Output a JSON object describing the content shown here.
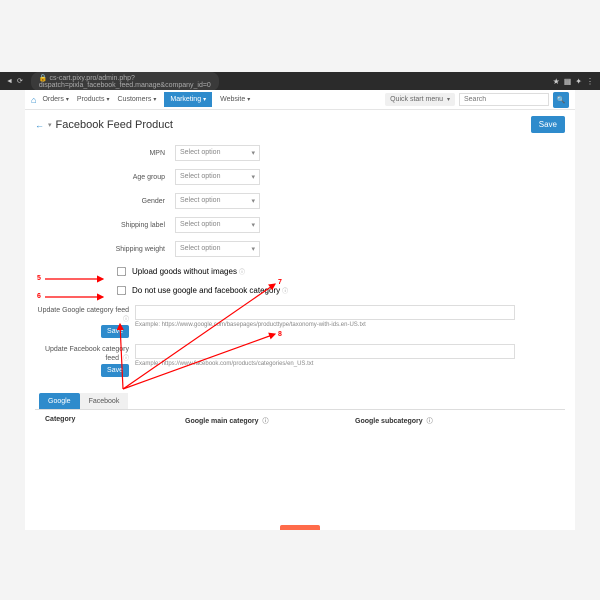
{
  "browser": {
    "url": "cs-cart.pixy.pro/admin.php?dispatch=pixla_facebook_feed.manage&company_id=0"
  },
  "nav": {
    "items": [
      "Orders",
      "Products",
      "Customers",
      "Marketing",
      "Website"
    ],
    "active": "Marketing",
    "quick": "Quick start menu",
    "search_placeholder": "Search"
  },
  "page": {
    "title": "Facebook Feed Product",
    "save": "Save"
  },
  "fields": {
    "mpn": {
      "label": "MPN",
      "value": "Select option"
    },
    "age_group": {
      "label": "Age group",
      "value": "Select option"
    },
    "gender": {
      "label": "Gender",
      "value": "Select option"
    },
    "shipping_label": {
      "label": "Shipping label",
      "value": "Select option"
    },
    "shipping_weight": {
      "label": "Shipping weight",
      "value": "Select option"
    }
  },
  "checkboxes": {
    "upload_no_images": "Upload goods without images",
    "no_google_fb_cat": "Do not use google and facebook category"
  },
  "feeds": {
    "google": {
      "label": "Update Google category feed",
      "example": "Example: https://www.google.com/basepages/producttype/taxonomy-with-ids.en-US.txt",
      "save": "Save"
    },
    "facebook": {
      "label": "Update Facebook category feed",
      "example": "Example: https://www.facebook.com/products/categories/en_US.txt",
      "save": "Save"
    }
  },
  "tabs": {
    "google": "Google",
    "facebook": "Facebook"
  },
  "table": {
    "category": "Category",
    "google_main": "Google main category",
    "google_sub": "Google subcategory"
  },
  "annotations": {
    "n5": "5",
    "n6": "6",
    "n7": "7",
    "n8": "8"
  }
}
